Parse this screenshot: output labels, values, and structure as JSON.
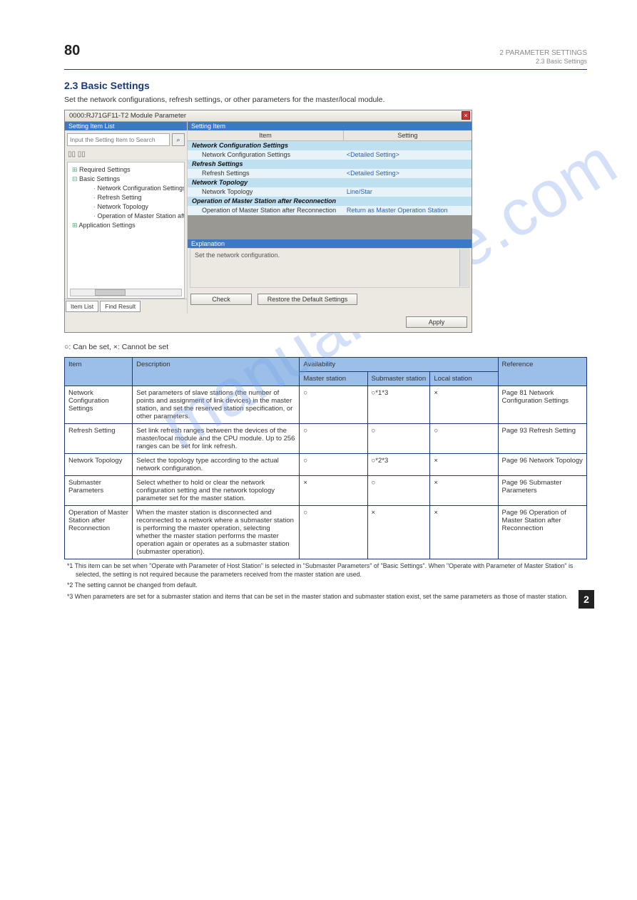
{
  "header": {
    "page_num": "80",
    "chapter": "2  PARAMETER SETTINGS",
    "sub": "2.3  Basic Settings"
  },
  "section_title": "Basic Settings",
  "lead": "Set the network configurations, refresh settings, or other parameters for the master/local module.",
  "window": {
    "title": "0000:RJ71GF11-T2 Module Parameter",
    "left_pane_title": "Setting Item List",
    "search_placeholder": "Input the Setting Item to Search",
    "tree": {
      "root1": "Required Settings",
      "root2": "Basic Settings",
      "l1": "Network Configuration Settings",
      "l2": "Refresh Setting",
      "l3": "Network Topology",
      "l4": "Operation of Master Station afte",
      "root3": "Application Settings"
    },
    "tabs": {
      "t1": "Item List",
      "t2": "Find Result"
    },
    "right_pane_title": "Setting Item",
    "grid_header": {
      "c1": "Item",
      "c2": "Setting"
    },
    "rows": {
      "cat1": "Network Configuration Settings",
      "r1a": "Network Configuration Settings",
      "r1b": "<Detailed Setting>",
      "cat2": "Refresh Settings",
      "r2a": "Refresh Settings",
      "r2b": "<Detailed Setting>",
      "cat3": "Network Topology",
      "r3a": "Network Topology",
      "r3b": "Line/Star",
      "cat4": "Operation of Master Station after Reconnection",
      "r4a": "Operation of Master Station after Reconnection",
      "r4b": "Return as Master Operation Station"
    },
    "explanation_title": "Explanation",
    "explanation_text": "Set the network configuration.",
    "btn_check": "Check",
    "btn_restore": "Restore the Default Settings",
    "btn_apply": "Apply"
  },
  "legend": "○: Can be set, ×: Cannot be set",
  "table": {
    "h_item": "Item",
    "h_desc": "Description",
    "h_avail": "Availability",
    "h_master": "Master station",
    "h_submaster": "Submaster station",
    "h_local": "Local station",
    "h_ref": "Reference",
    "rows": {
      "a": {
        "item": "Network Configuration Settings",
        "desc": "Set parameters of slave stations (the number of points and assignment of link devices) in the master station, and set the reserved station specification, or other parameters.",
        "m": "○",
        "s": "○*1*3",
        "l": "×",
        "ref": "Page 81 Network Configuration Settings"
      },
      "b": {
        "item": "Refresh Setting",
        "desc": "Set link refresh ranges between the devices of the master/local module and the CPU module. Up to 256 ranges can be set for link refresh.",
        "m": "○",
        "s": "○",
        "l": "○",
        "ref": "Page 93 Refresh Setting"
      },
      "c": {
        "item": "Network Topology",
        "desc": "Select the topology type according to the actual network configuration.",
        "m": "○",
        "s": "○*2*3",
        "l": "×",
        "ref": "Page 96 Network Topology"
      },
      "d": {
        "item": "Submaster Parameters",
        "desc": "Select whether to hold or clear the network configuration setting and the network topology parameter set for the master station.",
        "m": "×",
        "s": "○",
        "l": "×",
        "ref": "Page 96 Submaster Parameters"
      },
      "e": {
        "item": "Operation of Master Station after Reconnection",
        "desc": "When the master station is disconnected and reconnected to a network where a submaster station is performing the master operation, selecting whether the master station performs the master operation again or operates as a submaster station (submaster operation).",
        "m": "○",
        "s": "×",
        "l": "×",
        "ref": "Page 96 Operation of Master Station after Reconnection"
      }
    }
  },
  "footnotes": {
    "f1": "*1  This item can be set when \"Operate with Parameter of Host Station\" is selected in \"Submaster Parameters\" of \"Basic Settings\". When \"Operate with Parameter of Master Station\" is selected, the setting is not required because the parameters received from the master station are used.",
    "f2": "*2  The setting cannot be changed from default.",
    "f3": "*3  When parameters are set for a submaster station and items that can be set in the master station and submaster station exist, set the same parameters as those of master station."
  },
  "watermark": "manualshive.com",
  "chapter_mark": "2"
}
